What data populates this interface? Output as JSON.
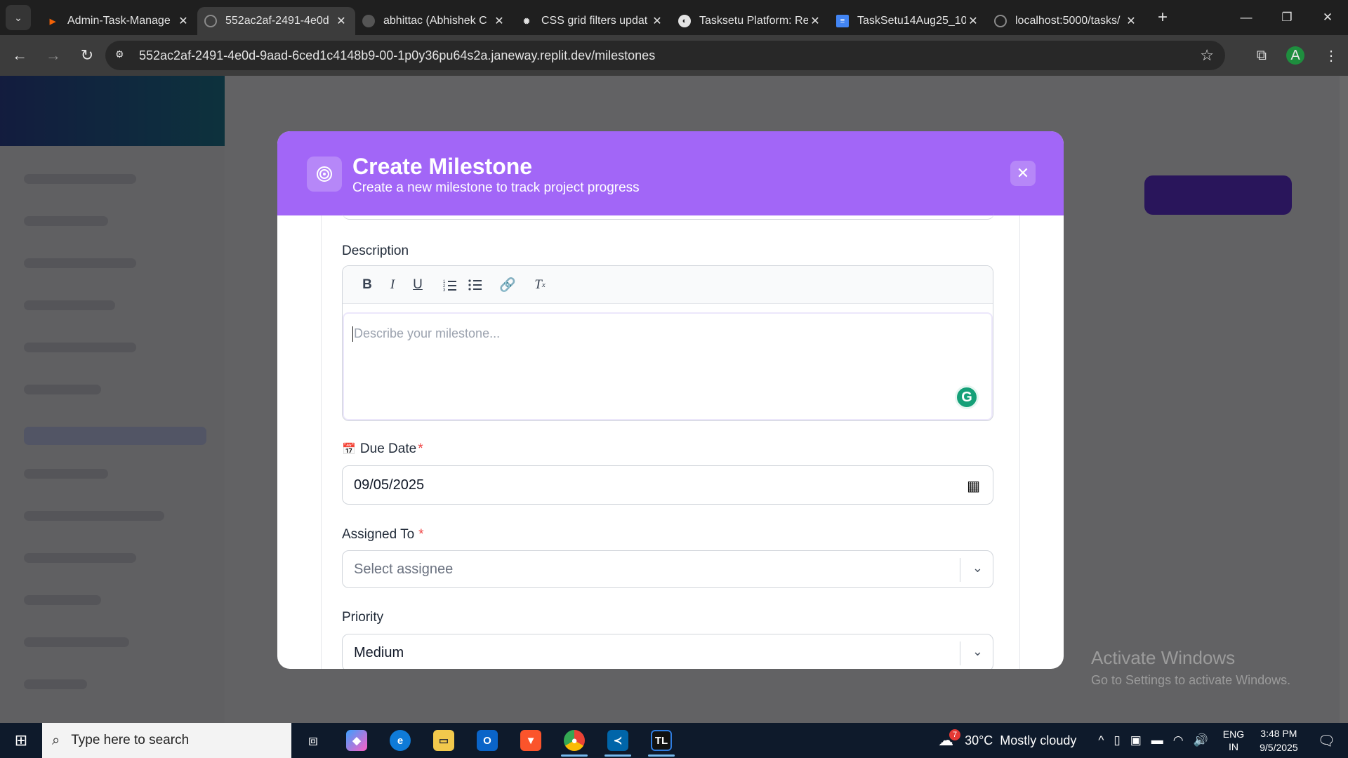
{
  "browser": {
    "tabs": [
      {
        "title": "Admin-Task-Manage",
        "favicon": "replit-icon",
        "color": "#f26207",
        "active": false
      },
      {
        "title": "552ac2af-2491-4e0d",
        "favicon": "globe-icon",
        "color": "#8a8a8a",
        "active": true
      },
      {
        "title": "abhittac (Abhishek C",
        "favicon": "github-icon",
        "color": "#555555",
        "active": false
      },
      {
        "title": "CSS grid filters updat",
        "favicon": "chatgpt-icon",
        "color": "#e3e3e3",
        "active": false
      },
      {
        "title": "Tasksetu Platform: Re",
        "favicon": "claude-icon",
        "color": "#e3e3e3",
        "active": false
      },
      {
        "title": "TaskSetu14Aug25_10",
        "favicon": "docs-icon",
        "color": "#4285f4",
        "active": false
      },
      {
        "title": "localhost:5000/tasks/",
        "favicon": "globe-icon",
        "color": "#8a8a8a",
        "active": false
      }
    ],
    "url": "552ac2af-2491-4e0d-9aad-6ced1c4148b9-00-1p0y36pu64s2a.janeway.replit.dev/milestones",
    "profile_initial": "A"
  },
  "modal": {
    "title": "Create Milestone",
    "subtitle": "Create a new milestone to track project progress",
    "header_color": "#a266f7",
    "description": {
      "label": "Description",
      "placeholder": "Describe your milestone...",
      "toolbar": [
        "bold-icon",
        "italic-icon",
        "underline-icon",
        "ordered-list-icon",
        "bullet-list-icon",
        "link-icon",
        "clear-format-icon"
      ]
    },
    "due_date": {
      "label": "Due Date",
      "required_mark": "*",
      "value": "09/05/2025"
    },
    "assigned_to": {
      "label": "Assigned To",
      "required_mark": "*",
      "placeholder": "Select assignee"
    },
    "priority": {
      "label": "Priority",
      "value": "Medium"
    }
  },
  "watermark": {
    "line1": "Activate Windows",
    "line2": "Go to Settings to activate Windows."
  },
  "taskbar": {
    "search_placeholder": "Type here to search",
    "weather": {
      "badge": "7",
      "temp": "30°C",
      "desc": "Mostly cloudy"
    },
    "lang": {
      "line1": "ENG",
      "line2": "IN"
    },
    "clock": {
      "time": "3:48 PM",
      "date": "9/5/2025"
    }
  }
}
